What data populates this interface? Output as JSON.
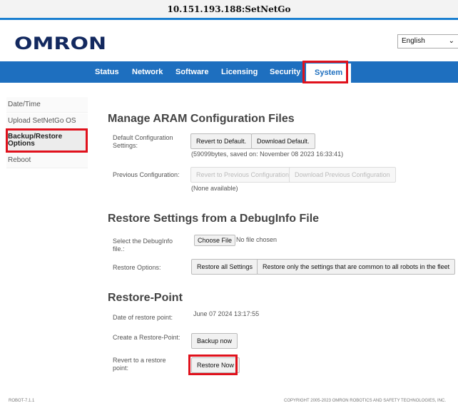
{
  "window": {
    "title": "10.151.193.188:SetNetGo"
  },
  "brand": {
    "logo": "OMRON"
  },
  "language": {
    "selected": "English"
  },
  "nav": {
    "items": [
      "Status",
      "Network",
      "Software",
      "Licensing",
      "Security",
      "System"
    ],
    "active": "System"
  },
  "sidebar": {
    "items": [
      "Date/Time",
      "Upload SetNetGo OS",
      "Backup/Restore Options",
      "Reboot"
    ],
    "active": "Backup/Restore Options"
  },
  "aram": {
    "heading": "Manage ARAM Configuration Files",
    "default_label": "Default Configuration Settings:",
    "revert_default": "Revert to Default.",
    "download_default": "Download Default.",
    "default_info": "(59099bytes, saved on: November 08 2023 16:33:41)",
    "previous_label": "Previous Configuration:",
    "revert_previous": "Revert to Previous Configuration",
    "download_previous": "Download Previous Configuration",
    "previous_info": "(None available)"
  },
  "debuginfo": {
    "heading": "Restore Settings from a DebugInfo File",
    "select_label": "Select the DebugInfo file.:",
    "choose_file": "Choose File",
    "no_file": "No file chosen",
    "options_label": "Restore Options:",
    "restore_all": "Restore all Settings",
    "restore_common": "Restore only the settings that are common to all robots in the fleet"
  },
  "restore_point": {
    "heading": "Restore-Point",
    "date_label": "Date of restore point:",
    "date_value": "June 07 2024 13:17:55",
    "create_label": "Create a Restore-Point:",
    "backup_now": "Backup now",
    "revert_label": "Revert to a restore point:",
    "restore_now": "Restore Now"
  },
  "footer": {
    "version": "ROBOT-7.1.1",
    "copyright": "COPYRIGHT 2005-2023 OMRON ROBOTICS AND SAFETY TECHNOLOGIES, INC."
  },
  "colors": {
    "nav_bg": "#1e6fbf",
    "highlight": "#e0111c",
    "brand": "#13295f"
  }
}
